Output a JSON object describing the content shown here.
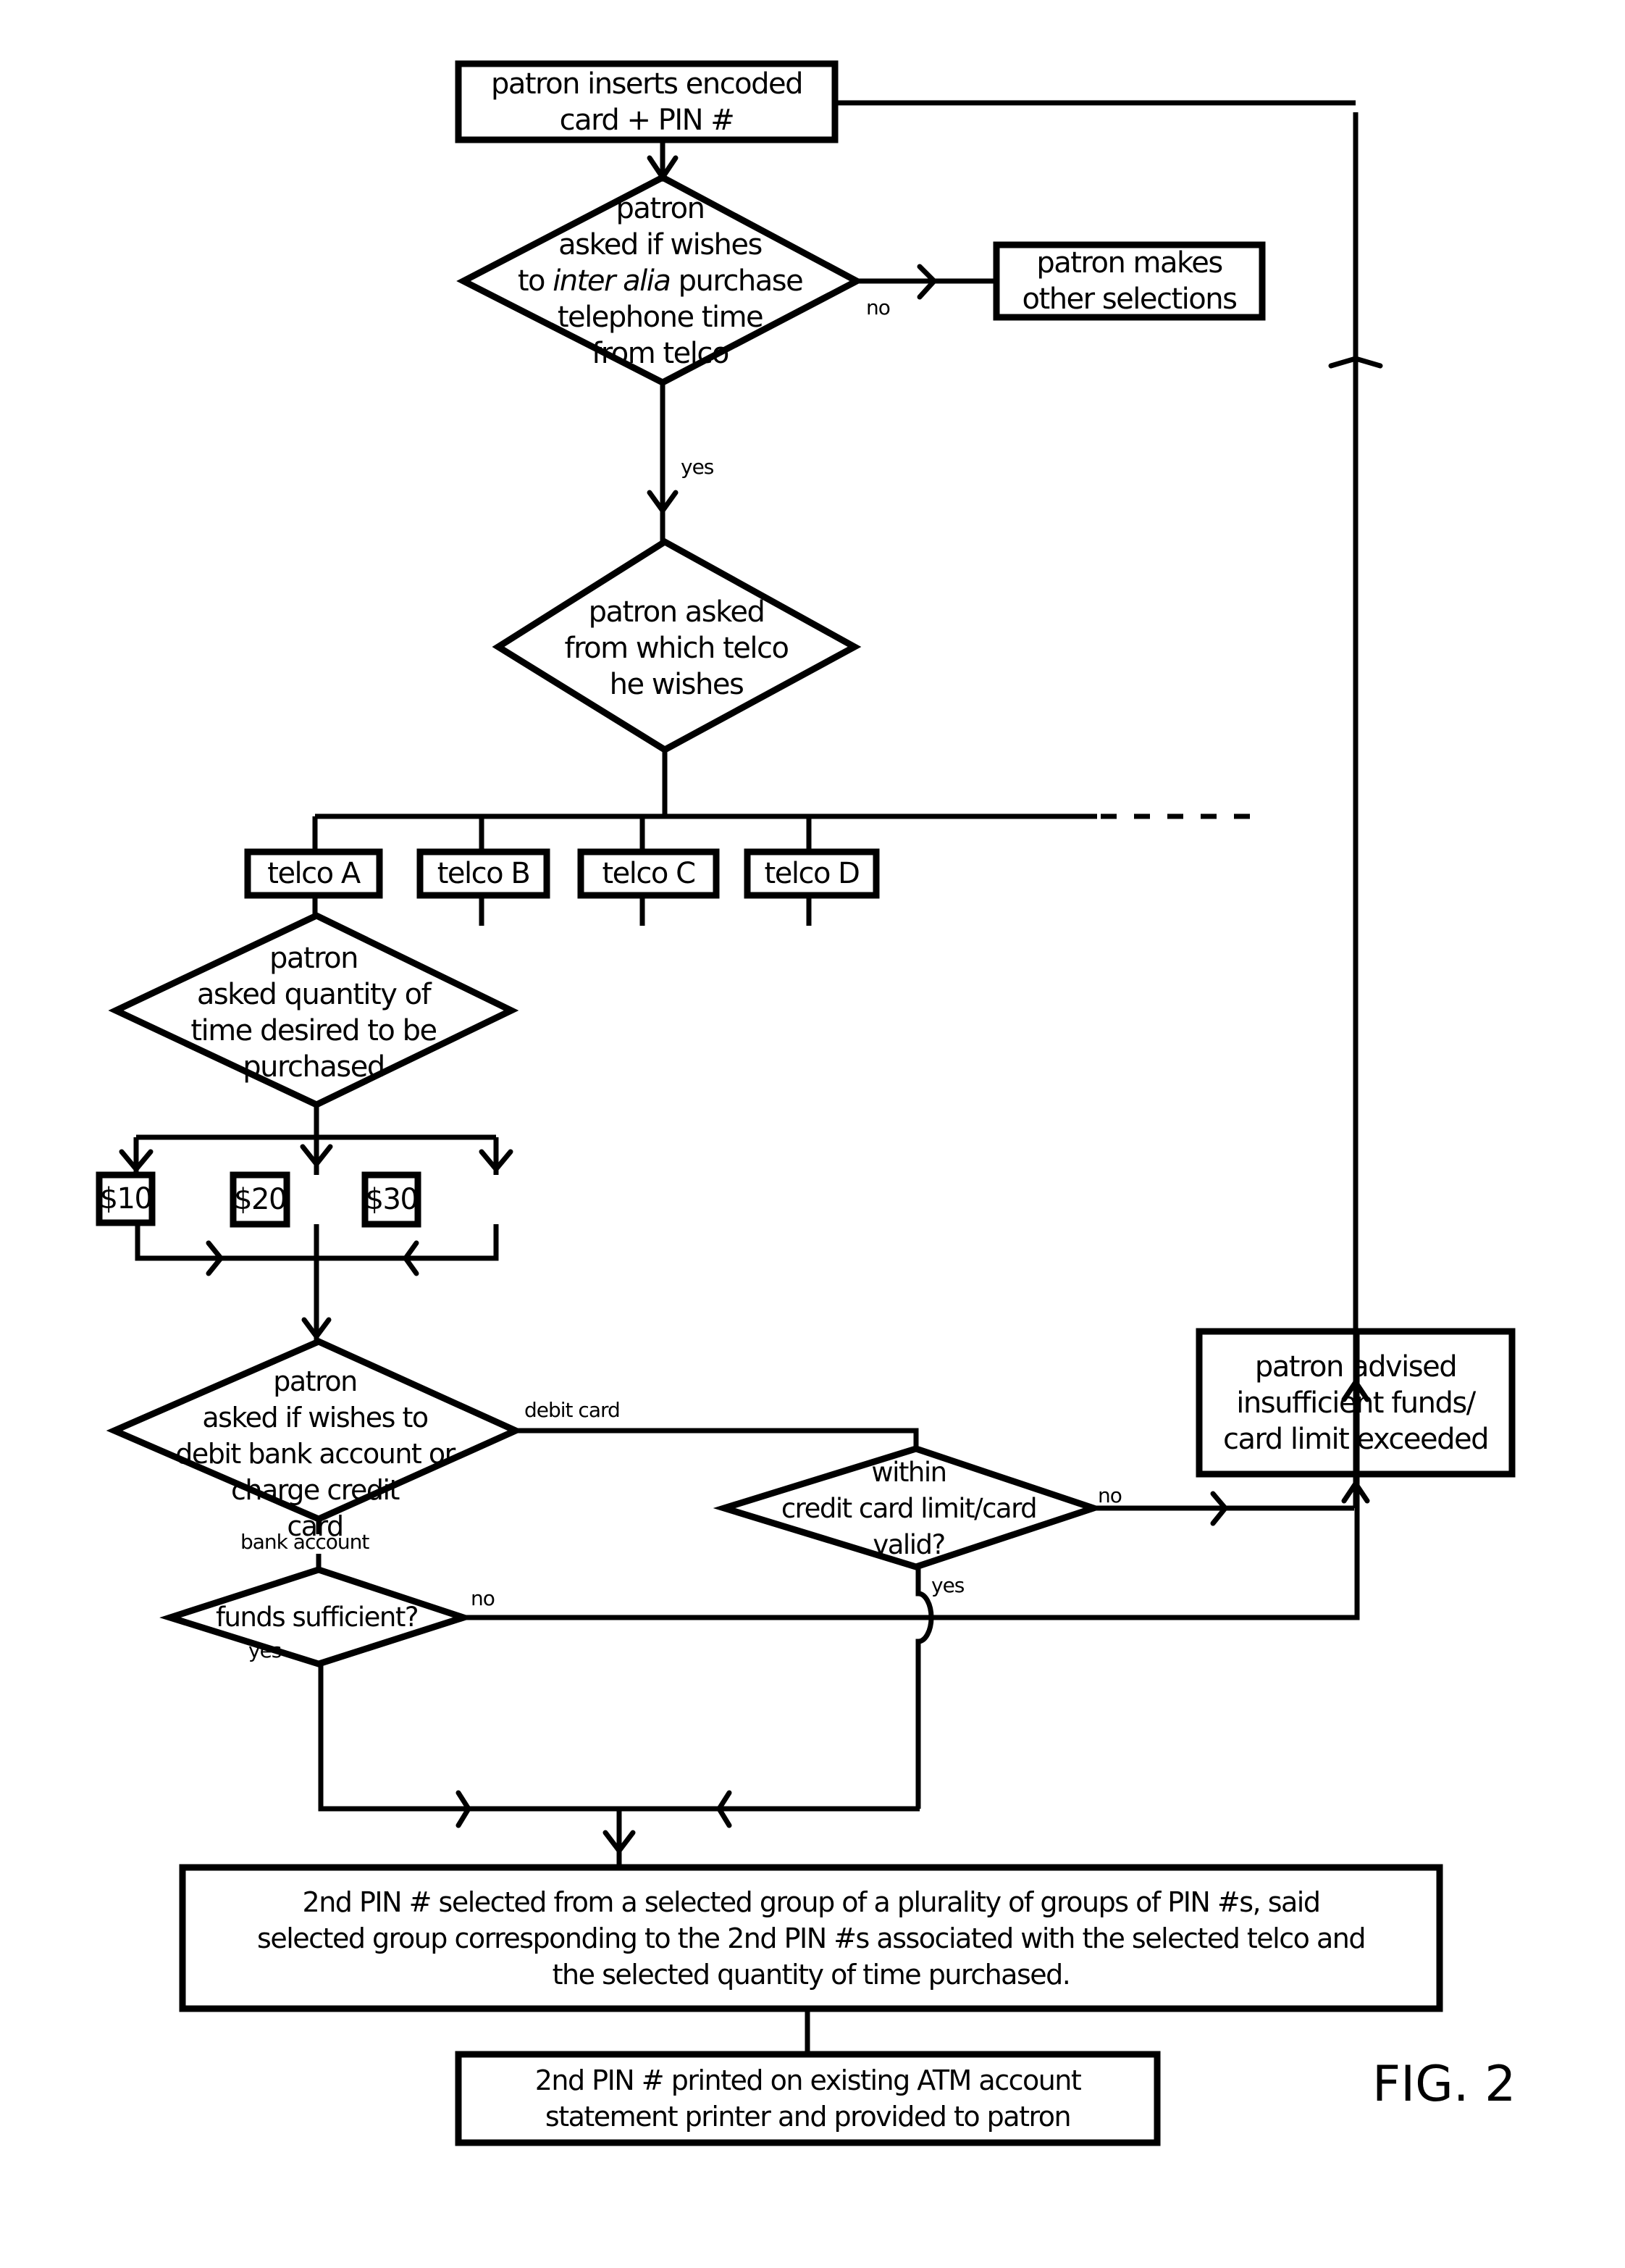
{
  "figure_label": "FIG. 2",
  "nodes": {
    "start": {
      "type": "process",
      "lines": [
        "patron inserts encoded",
        "card + PIN #"
      ]
    },
    "ask_purchase": {
      "type": "decision",
      "lines": [
        "patron",
        "asked if wishes",
        "to @inter alia@ purchase",
        "telephone time",
        "from telco"
      ],
      "pre_italic": "to ",
      "italic": "inter alia",
      "post_italic": " purchase"
    },
    "other_selections": {
      "type": "process",
      "lines": [
        "patron makes",
        "other selections"
      ]
    },
    "ask_telco": {
      "type": "decision",
      "lines": [
        "patron asked",
        "from which telco",
        "he wishes"
      ]
    },
    "telcos": [
      {
        "label": "telco A"
      },
      {
        "label": "telco B"
      },
      {
        "label": "telco C"
      },
      {
        "label": "telco D"
      }
    ],
    "ask_quantity": {
      "type": "decision",
      "lines": [
        "patron",
        "asked quantity of",
        "time desired to be",
        "purchased"
      ]
    },
    "amounts": [
      {
        "label": "$10"
      },
      {
        "label": "$20"
      },
      {
        "label": "$30"
      }
    ],
    "ask_payment": {
      "type": "decision",
      "lines": [
        "patron",
        "asked if wishes to",
        "debit bank account or",
        "charge credit",
        "card"
      ]
    },
    "credit_check": {
      "type": "decision",
      "lines": [
        "within",
        "credit card limit/card",
        "valid?"
      ]
    },
    "insufficient": {
      "type": "process",
      "lines": [
        "patron advised",
        "insufficient funds/",
        "card limit exceeded"
      ]
    },
    "funds_check": {
      "type": "decision",
      "lines": [
        "funds sufficient?"
      ]
    },
    "select_pin": {
      "type": "process",
      "lines": [
        "2nd PIN # selected from a selected group of a plurality of groups of PIN #s, said",
        "selected group corresponding to the 2nd PIN #s associated with the selected telco and",
        "the selected quantity of time purchased."
      ]
    },
    "print_pin": {
      "type": "process",
      "lines": [
        "2nd PIN # printed on existing ATM account",
        "statement printer and provided to patron"
      ]
    }
  },
  "edge_labels": {
    "purchase_no": "no",
    "purchase_yes": "yes",
    "debit_card": "debit card",
    "bank_account": "bank account",
    "credit_no": "no",
    "credit_yes": "yes",
    "funds_no": "no",
    "funds_yes": "yes"
  },
  "colors": {
    "ink": "#000000",
    "paper": "#ffffff"
  }
}
